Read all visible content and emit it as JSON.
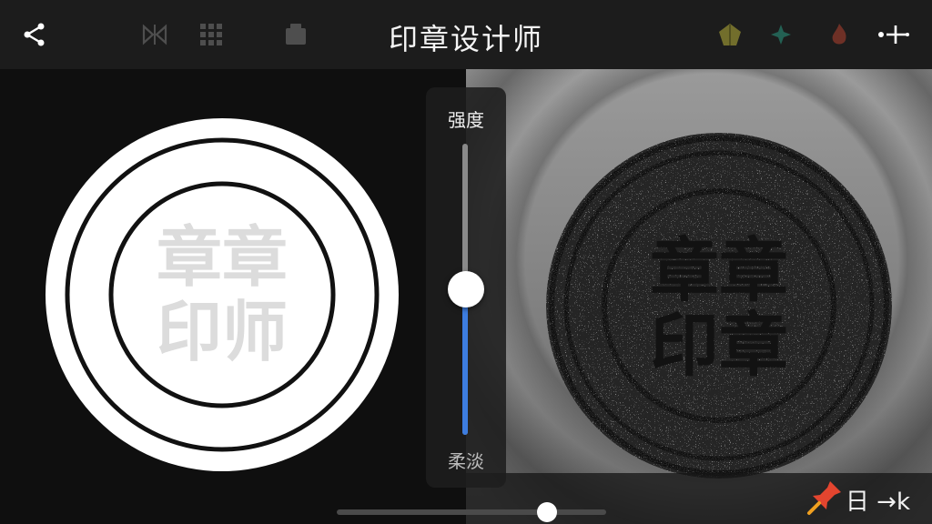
{
  "app": {
    "title": "印章设计师"
  },
  "toolbar": {
    "share_icon": "share-icon",
    "left_dim_icons": [
      "mirror-icon",
      "grid-icon",
      "layer-icon"
    ],
    "right_icons": [
      "pentagon-icon",
      "sparkle-icon",
      "flame-icon",
      "add-more-icon"
    ]
  },
  "preview": {
    "left_stamp": {
      "line1": "章章",
      "line2": "印师"
    },
    "right_stamp": {
      "line1": "章章",
      "line2": "印章"
    }
  },
  "slider": {
    "label_top": "强度",
    "label_bottom": "柔淡",
    "value_fraction": 0.5,
    "accent": "#3d7de0"
  },
  "bottombar": {
    "action_text": "日 →k",
    "pin_icon": "pin-icon",
    "scrub_fraction": 0.78
  }
}
